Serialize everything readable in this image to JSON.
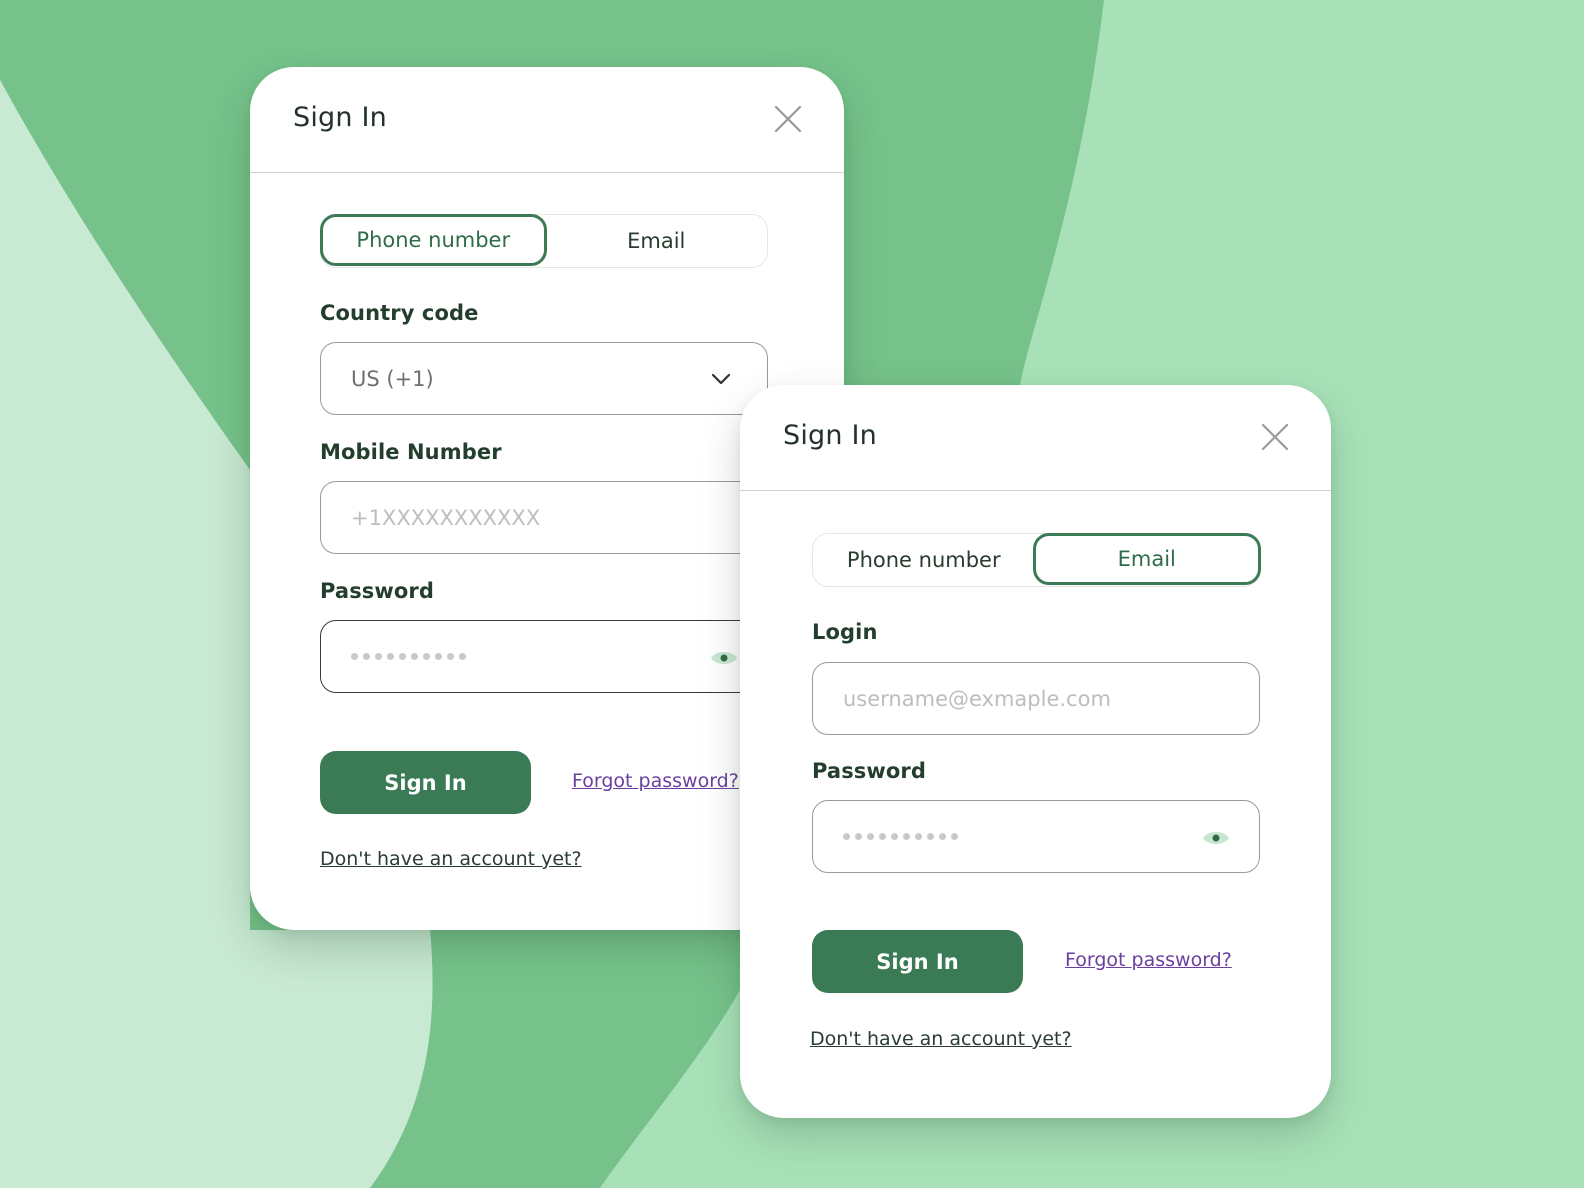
{
  "colors": {
    "background_light": "#a8e1b8",
    "background_pale": "#c8e9d2",
    "background_mid": "#76c28a",
    "accent": "#3a7b56",
    "link": "#6b3fa0"
  },
  "card_phone": {
    "title": "Sign In",
    "close_icon": "close-icon",
    "tabs": [
      {
        "label": "Phone number",
        "active": true
      },
      {
        "label": "Email",
        "active": false
      }
    ],
    "country_code": {
      "label": "Country code",
      "value": "US (+1)",
      "icon": "chevron-down-icon"
    },
    "mobile": {
      "label": "Mobile Number",
      "placeholder": "+1XXXXXXXXXXX"
    },
    "password": {
      "label": "Password",
      "icon": "eye-icon"
    },
    "submit_label": "Sign In",
    "forgot_label": "Forgot password?",
    "signup_label": "Don't have an account yet?"
  },
  "card_email": {
    "title": "Sign In",
    "close_icon": "close-icon",
    "tabs": [
      {
        "label": "Phone number",
        "active": false
      },
      {
        "label": "Email",
        "active": true
      }
    ],
    "login": {
      "label": "Login",
      "placeholder": "username@exmaple.com"
    },
    "password": {
      "label": "Password",
      "icon": "eye-icon"
    },
    "submit_label": "Sign In",
    "forgot_label": "Forgot password?",
    "signup_label": "Don't have an account yet?"
  }
}
